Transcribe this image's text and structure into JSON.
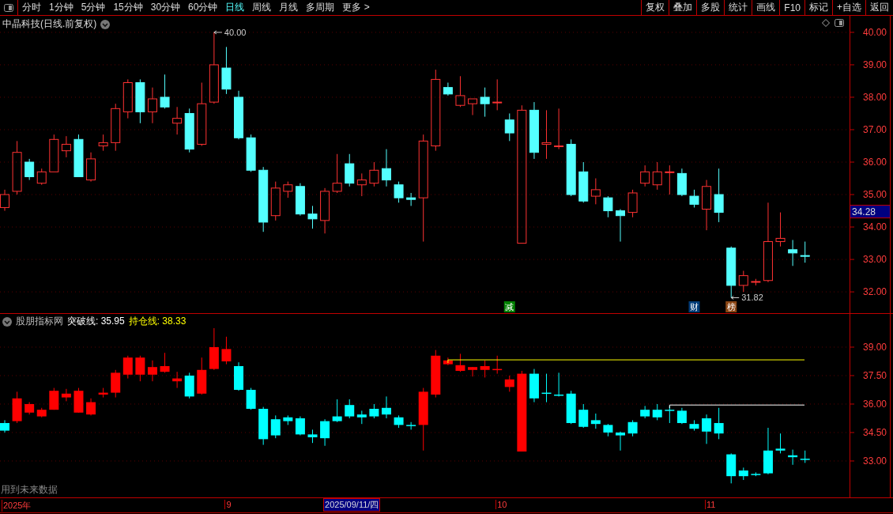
{
  "toolbar": {
    "periods": [
      {
        "label": "分时",
        "selected": false
      },
      {
        "label": "1分钟",
        "selected": false
      },
      {
        "label": "5分钟",
        "selected": false
      },
      {
        "label": "15分钟",
        "selected": false
      },
      {
        "label": "30分钟",
        "selected": false
      },
      {
        "label": "60分钟",
        "selected": false
      },
      {
        "label": "日线",
        "selected": true
      },
      {
        "label": "周线",
        "selected": false
      },
      {
        "label": "月线",
        "selected": false
      },
      {
        "label": "多周期",
        "selected": false
      },
      {
        "label": "更多 >",
        "selected": false
      }
    ],
    "actions": [
      "复权",
      "叠加",
      "多股",
      "统计",
      "画线",
      "F10",
      "标记",
      "+自选",
      "返回"
    ]
  },
  "price_panel": {
    "title": "中晶科技(日线.前复权)",
    "current_price": "34.28",
    "high_marker": "40.00",
    "low_marker": "31.82",
    "price_axis": [
      "40.00",
      "39.00",
      "38.00",
      "37.00",
      "36.00",
      "35.00",
      "34.00",
      "33.00",
      "32.00"
    ],
    "event_badges": [
      {
        "label": "减",
        "color": "#008000"
      },
      {
        "label": "财",
        "color": "#003c78"
      },
      {
        "label": "榜",
        "color": "#8b4513"
      }
    ]
  },
  "indicator_panel": {
    "name": "股朋指标网",
    "lines": [
      {
        "label": "突破线: 35.95",
        "color": "#ffffff"
      },
      {
        "label": "持仓线: 38.33",
        "color": "#ffff00"
      }
    ],
    "footnote": "用到未来数据",
    "price_axis": [
      "39.00",
      "37.50",
      "36.00",
      "34.50",
      "33.00"
    ]
  },
  "time_axis": [
    {
      "label": "2025年",
      "selected": false
    },
    {
      "label": "9",
      "selected": false
    },
    {
      "label": "2025/09/11/四",
      "selected": true
    },
    {
      "label": "10",
      "selected": false
    },
    {
      "label": "11",
      "selected": false
    }
  ]
}
